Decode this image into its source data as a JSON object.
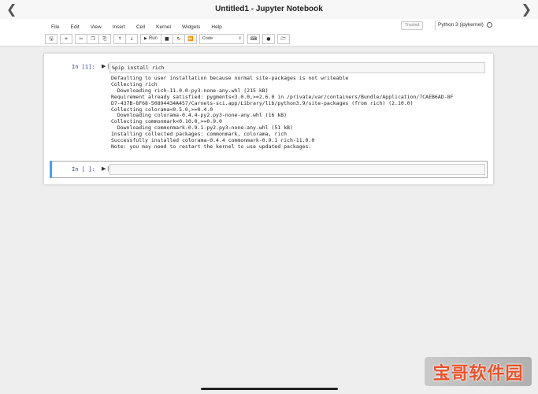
{
  "window": {
    "title": "Untitled1 - Jupyter Notebook"
  },
  "menu": [
    "File",
    "Edit",
    "View",
    "Insert",
    "Cell",
    "Kernel",
    "Widgets",
    "Help"
  ],
  "status": {
    "trusted": "Trusted",
    "kernel": "Python 3 (ipykernel)"
  },
  "toolbar": {
    "run_label": "Run",
    "cell_type": "Code"
  },
  "icons": {
    "back": "chevron-left-icon",
    "forward": "chevron-right-icon",
    "save": "save-icon",
    "add": "plus-icon",
    "cut": "cut-icon",
    "copy": "copy-icon",
    "paste": "paste-icon",
    "up": "arrow-up-icon",
    "down": "arrow-down-icon",
    "run": "play-icon",
    "stop": "stop-icon",
    "restart": "restart-icon",
    "fastforward": "fast-forward-icon",
    "keyboard": "keyboard-icon",
    "circle": "record-icon",
    "folder": "folder-icon"
  },
  "cells": [
    {
      "prompt": "In [1]:",
      "source": "%pip install rich",
      "output": "Defaulting to user installation because normal site-packages is not writeable\nCollecting rich\n  Downloading rich-11.0.0-py3-none-any.whl (215 kB)\nRequirement already satisfied: pygments<3.0.0,>=2.6.0 in /private/var/containers/Bundle/Application/7CAEB6AD-8F\nD7-437B-8F68-50894434A457/Carnets-sci.app/Library/lib/python3.9/site-packages (from rich) (2.10.0)\nCollecting colorama<0.5.0,>=0.4.0\n  Downloading colorama-0.4.4-py2.py3-none-any.whl (16 kB)\nCollecting commonmark<0.10.0,>=0.9.0\n  Downloading commonmark-0.9.1-py2.py3-none-any.whl (51 kB)\nInstalling collected packages: commonmark, colorama, rich\nSuccessfully installed colorama-0.4.4 commonmark-0.9.1 rich-11.0.0\nNote: you may need to restart the kernel to use updated packages."
    },
    {
      "prompt": "In [ ]:",
      "source": ""
    }
  ],
  "colors": {
    "prompt": "#303f9f",
    "selected_cell": "#42a5f5"
  },
  "watermark": "宝哥软件园"
}
